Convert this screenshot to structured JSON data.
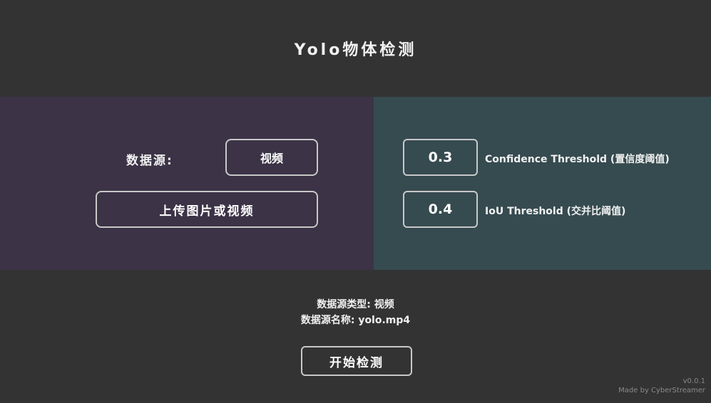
{
  "header": {
    "title": "Yolo物体检测"
  },
  "source": {
    "label": "数据源:",
    "selected": "视频",
    "upload_label": "上传图片或视频"
  },
  "thresholds": {
    "confidence_value": "0.3",
    "confidence_label": "Confidence Threshold (置信度阈值)",
    "iou_value": "0.4",
    "iou_label": "IoU Threshold (交并比阈值)"
  },
  "info": {
    "source_type": "数据源类型: 视频",
    "source_name": "数据源名称: yolo.mp4"
  },
  "actions": {
    "start_label": "开始检测"
  },
  "footer": {
    "version": "v0.0.1",
    "made_by": "Made by CyberStreamer"
  },
  "colors": {
    "background": "#333333",
    "left_panel": "#3c3346",
    "right_panel": "#364b50",
    "border": "#c8c8c8"
  }
}
